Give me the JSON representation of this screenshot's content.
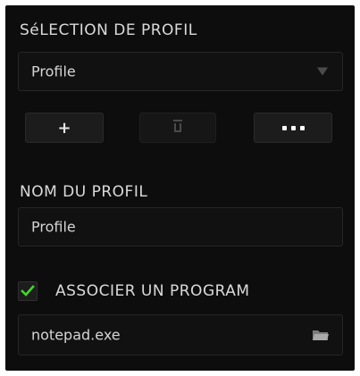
{
  "profile_selection": {
    "title": "SéLECTION DE PROFIL",
    "selected_profile": "Profile",
    "add_button_label": "+",
    "delete_icon": "trash-icon",
    "more_icon": "more-options-icon"
  },
  "profile_name": {
    "title": "NOM DU PROFIL",
    "value": "Profile"
  },
  "link_program": {
    "checked": true,
    "label": "ASSOCIER UN PROGRAM",
    "program_value": "notepad.exe",
    "browse_icon": "folder-icon"
  },
  "colors": {
    "panel_bg": "#0d0d0d",
    "accent": "#44d62c"
  }
}
